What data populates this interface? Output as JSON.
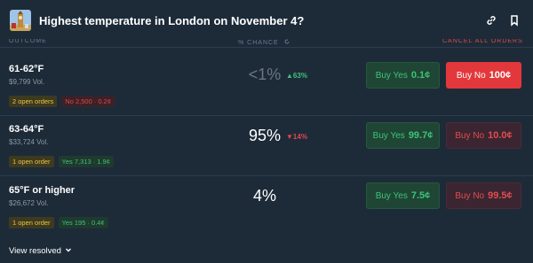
{
  "header": {
    "title": "Highest temperature in London on November 4?"
  },
  "columns": {
    "outcome": "OUTCOME",
    "chance": "% CHANCE",
    "cancel_all": "CANCEL ALL ORDERS"
  },
  "rows": [
    {
      "name": "61-62°F",
      "volume": "$9,799 Vol.",
      "orders": "2 open orders",
      "position": "No 2,500 · 0.2¢",
      "position_side": "no",
      "chance": "<1%",
      "change": "▲63%",
      "change_dir": "up",
      "buy_yes_label": "Buy Yes",
      "buy_yes_price": "0.1¢",
      "buy_no_label": "Buy No",
      "buy_no_price": "100¢"
    },
    {
      "name": "63-64°F",
      "volume": "$33,724 Vol.",
      "orders": "1 open order",
      "position": "Yes 7,313 · 1.9¢",
      "position_side": "yes",
      "chance": "95%",
      "change": "▼14%",
      "change_dir": "down",
      "buy_yes_label": "Buy Yes",
      "buy_yes_price": "99.7¢",
      "buy_no_label": "Buy No",
      "buy_no_price": "10.0¢"
    },
    {
      "name": "65°F or higher",
      "volume": "$26,672 Vol.",
      "orders": "1 open order",
      "position": "Yes 195 · 0.4¢",
      "position_side": "yes",
      "chance": "4%",
      "change": "",
      "change_dir": "",
      "buy_yes_label": "Buy Yes",
      "buy_yes_price": "7.5¢",
      "buy_no_label": "Buy No",
      "buy_no_price": "99.5¢"
    }
  ],
  "footer": {
    "view_resolved": "View resolved"
  },
  "colors": {
    "background": "#1d2b39",
    "green": "#3ec27a",
    "red": "#e2474b",
    "yellow": "#e9c54a"
  },
  "icons": [
    "big-ben-thumbnail",
    "link-icon",
    "bookmark-icon",
    "refresh-icon",
    "chevron-down-icon",
    "triangle-up-icon",
    "triangle-down-icon"
  ]
}
